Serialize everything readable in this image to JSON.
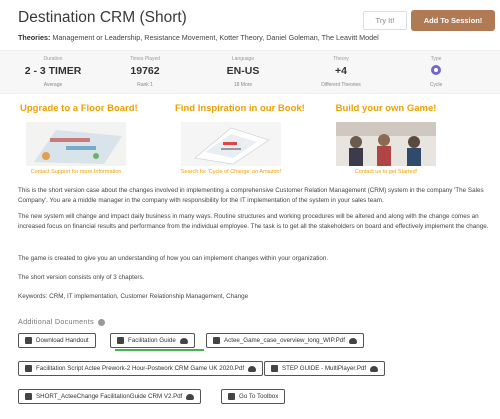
{
  "header": {
    "title": "Destination CRM (Short)",
    "theories_label": "Theories:",
    "theories_value": "Management or Leadership, Resistance Movement, Kotter Theory, Daniel Goleman, The Leavitt Model",
    "try_button": "Try It!",
    "add_button": "Add To Session!"
  },
  "stats": [
    {
      "label": "Duration",
      "value": "2 - 3 TIMER",
      "sub": "Average"
    },
    {
      "label": "Times Played",
      "value": "19762",
      "sub": "Rank 1"
    },
    {
      "label": "Language",
      "value": "EN-US",
      "sub": "18 More"
    },
    {
      "label": "Theory",
      "value": "+4",
      "sub": "Different Theories"
    },
    {
      "label": "Type",
      "value": "",
      "sub": "Cycle",
      "icon": "cycle-icon"
    }
  ],
  "promos": [
    {
      "title": "Upgrade to a Floor Board!",
      "link": "Contact Support for more Information"
    },
    {
      "title": "Find Inspiration in our Book!",
      "link": "Search for 'Cycle of Change' on Amazon!"
    },
    {
      "title": "Build your own Game!",
      "link": "Contact us to get Started!"
    }
  ],
  "description": [
    "This is the short version case about the changes involved in implementing a comprehensive Customer Relation Management (CRM) system in the company 'The Sales Company'. You are a middle manager in the company with responsibility for the IT implementation of the system in your sales team.",
    "The new system will change and impact daily business in many ways. Routine structures and working procedures will be altered and along with the change comes an increased focus on financial results and performance from the individual employee. The task is to get all the stakeholders on board and effectively implement the change.",
    "The game is created to give you an understanding of how you can implement changes within your organization.",
    "The short version consists only of 3 chapters.",
    "Keywords: CRM, IT implementation, Customer Relationship Management, Change"
  ],
  "additional_documents": "Additional Documents",
  "documents": [
    "Download Handout",
    "Facilitation Guide",
    "Actee_Game_case_overview_long_WIP.Pdf",
    "Facilitation Script Actee Prework-2 Hour-Postwork CRM Game UK 2020.Pdf",
    "STEP GUIDE - MultiPlayer.Pdf",
    "SHORT_ActeeChange FacilitationGuide CRM V2.Pdf",
    "Go To Toolbox"
  ],
  "colors": {
    "accent": "#f0a000",
    "add_button": "#b07a55",
    "active_underline": "#46b34b",
    "cycle_icon": "#7766d0"
  }
}
